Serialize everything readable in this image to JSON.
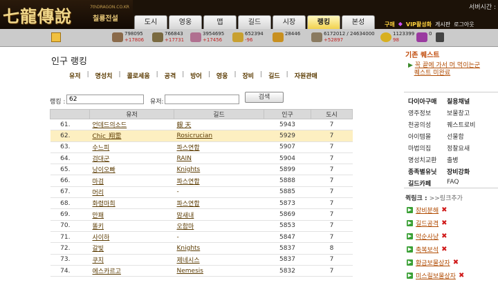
{
  "header": {
    "logo_main": "七龍傳說",
    "logo_url": "7thDRAGON.CO.KR",
    "logo_sub": "칠룡전설",
    "server_time_label": "서버시간 :",
    "nav_tabs": [
      "도시",
      "영웅",
      "맵",
      "길드",
      "시장",
      "랭킹",
      "본성"
    ],
    "active_tab": "랭킹",
    "links": {
      "buy": "구매",
      "vip": "VIP활성화",
      "board": "게시판",
      "logout": "로그아웃"
    }
  },
  "resources": [
    {
      "value": "798095",
      "inc": "+17806",
      "color": "#8a6a4a"
    },
    {
      "value": "766843",
      "inc": "+17731",
      "color": "#7a6a40"
    },
    {
      "value": "3954695",
      "inc": "+17456",
      "color": "#b07090"
    },
    {
      "value": "652394",
      "inc": "-96",
      "color": "#c8a030"
    },
    {
      "value": "28446",
      "inc": "",
      "color": "#c89020"
    },
    {
      "value": "6172012 / 24634000",
      "inc": "+52897",
      "color": "#8a7a60"
    },
    {
      "value": "1123399",
      "inc": "98",
      "color": "#d8b020"
    },
    {
      "value": "0",
      "inc": "",
      "color": "#9a3aa0"
    }
  ],
  "main": {
    "title": "인구 랭킹",
    "subtabs": [
      "유저",
      "명성치",
      "콜로세움",
      "공격",
      "방어",
      "영웅",
      "장비",
      "길드",
      "자원관매"
    ],
    "search": {
      "rank_label": "랭킹 :",
      "rank_value": "62",
      "user_label": "유저:",
      "user_value": "",
      "button": "검색"
    },
    "table": {
      "headers": [
        "",
        "유저",
        "길드",
        "인구",
        "도시"
      ],
      "rows": [
        {
          "rank": "61.",
          "user": "언데드의소드",
          "guild": "銀 天",
          "pop": "5943",
          "city": "7",
          "hl": false
        },
        {
          "rank": "62.",
          "user": "Chic_翔霊",
          "guild": "Rosicrucian",
          "pop": "5929",
          "city": "7",
          "hl": true
        },
        {
          "rank": "63.",
          "user": "수느피",
          "guild": "파스연합",
          "pop": "5907",
          "city": "7",
          "hl": false
        },
        {
          "rank": "64.",
          "user": "검대군",
          "guild": "RAIN",
          "pop": "5904",
          "city": "7",
          "hl": false
        },
        {
          "rank": "65.",
          "user": "낭이오빠",
          "guild": "Knights",
          "pop": "5899",
          "city": "7",
          "hl": false
        },
        {
          "rank": "66.",
          "user": "마검",
          "guild": "파스연합",
          "pop": "5888",
          "city": "7",
          "hl": false
        },
        {
          "rank": "67.",
          "user": "머리",
          "guild": "-",
          "pop": "5885",
          "city": "7",
          "hl": false
        },
        {
          "rank": "68.",
          "user": "화령마희",
          "guild": "파스연합",
          "pop": "5873",
          "city": "7",
          "hl": false
        },
        {
          "rank": "69.",
          "user": "만패",
          "guild": "맘새내",
          "pop": "5869",
          "city": "7",
          "hl": false
        },
        {
          "rank": "70.",
          "user": "똘키",
          "guild": "오함마",
          "pop": "5853",
          "city": "7",
          "hl": false
        },
        {
          "rank": "71.",
          "user": "사이하",
          "guild": "-",
          "pop": "5847",
          "city": "7",
          "hl": false
        },
        {
          "rank": "72.",
          "user": "갈빛",
          "guild": "Knights",
          "pop": "5837",
          "city": "8",
          "hl": false
        },
        {
          "rank": "73.",
          "user": "쿠지",
          "guild": "제네시스",
          "pop": "5837",
          "city": "7",
          "hl": false
        },
        {
          "rank": "74.",
          "user": "에스카르고",
          "guild": "Nemesis",
          "pop": "5832",
          "city": "7",
          "hl": false
        }
      ]
    }
  },
  "sidebar": {
    "quest_header": "기존 퀘스트",
    "quest_line1": "꼭 끝에 가서 머 먹이는군",
    "quest_line2": "퀘스트 미완료",
    "menu": [
      [
        "다이아구매",
        "칠용채널"
      ],
      [
        "영주정보",
        "보물창고"
      ],
      [
        "천공의성",
        "퀘스트로비"
      ],
      [
        "아이템몰",
        "선물함"
      ],
      [
        "마법의집",
        "정찰요새"
      ],
      [
        "명성치교환",
        "출병"
      ],
      [
        "종족별유닛",
        "장비강화"
      ],
      [
        "길드카페",
        "FAQ"
      ]
    ],
    "quick_header": "퀵링크 :",
    "quick_add": ">>링크추가",
    "quick_links": [
      "장비분해",
      "길드공격",
      "악순사냥",
      "축복보석",
      "황금보물상자",
      "미스릴보물상자"
    ]
  }
}
